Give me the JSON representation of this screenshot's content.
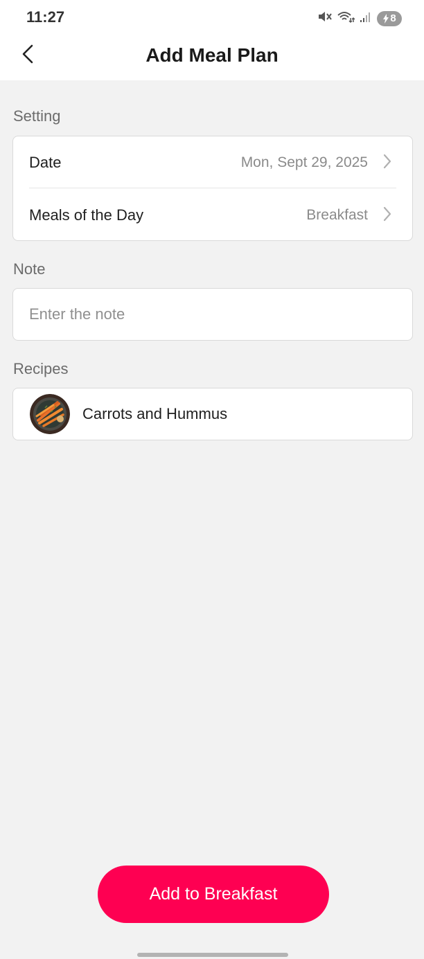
{
  "status_bar": {
    "time": "11:27",
    "battery": "8",
    "icons": [
      "mute-icon",
      "wifi-icon",
      "signal-icon",
      "battery-icon"
    ]
  },
  "header": {
    "title": "Add Meal Plan",
    "back_icon": "chevron-left-icon"
  },
  "setting": {
    "section_label": "Setting",
    "date_label": "Date",
    "date_value": "Mon, Sept 29, 2025",
    "meal_label": "Meals of the Day",
    "meal_value": "Breakfast"
  },
  "note": {
    "section_label": "Note",
    "placeholder": "Enter the note",
    "value": ""
  },
  "recipes": {
    "section_label": "Recipes",
    "items": [
      {
        "name": "Carrots and Hummus",
        "thumbnail": "carrots-dish-image"
      }
    ]
  },
  "footer": {
    "primary_button_label": "Add to Breakfast"
  },
  "colors": {
    "accent": "#fe0052",
    "background": "#f2f2f2",
    "card": "#ffffff"
  }
}
